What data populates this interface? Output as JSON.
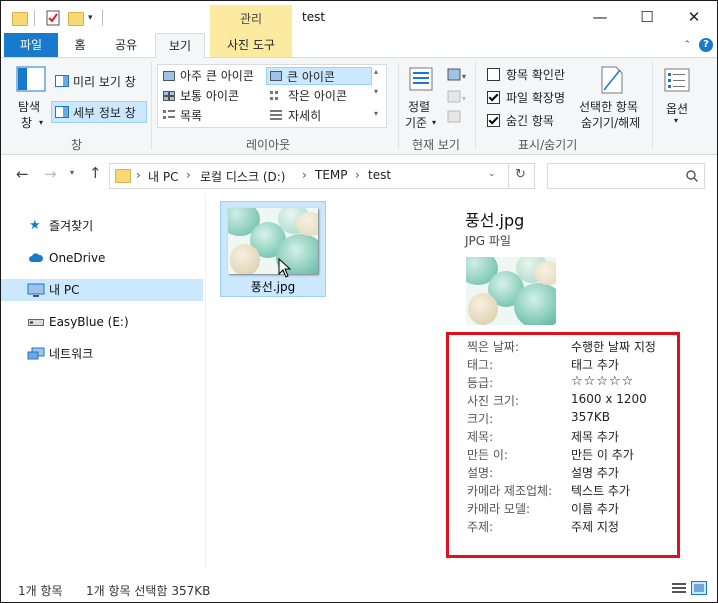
{
  "window": {
    "title": "test",
    "context_tab": "관리",
    "min_glyph": "—",
    "max_glyph": "☐",
    "close_glyph": "✕"
  },
  "tabs": {
    "file": "파일",
    "home": "홈",
    "share": "공유",
    "view": "보기",
    "picture_tools": "사진 도구",
    "help": "?"
  },
  "ribbon": {
    "pane_group": {
      "navpane_label_1": "탐색",
      "navpane_label_2": "창",
      "preview": "미리 보기 창",
      "details": "세부 정보 창",
      "group_label": "창"
    },
    "layout_group": {
      "items": [
        "아주 큰 아이콘",
        "큰 아이콘",
        "보통 아이콘",
        "작은 아이콘",
        "목록",
        "자세히"
      ],
      "group_label": "레이아웃"
    },
    "current_view_group": {
      "sort_1": "정렬",
      "sort_2": "기준",
      "group_label": "현재 보기"
    },
    "showhide_group": {
      "checkbox_item": "항목 확인란",
      "file_ext": "파일 확장명",
      "hidden_items": "숨긴 항목",
      "hide_selected_1": "선택한 항목",
      "hide_selected_2": "숨기기/해제",
      "group_label": "표시/숨기기"
    },
    "options": "옵션"
  },
  "address": {
    "path": [
      "내 PC",
      "로컬 디스크 (D:)",
      "TEMP",
      "test"
    ],
    "sep": "›"
  },
  "nav": {
    "items": [
      {
        "label": "즐겨찾기"
      },
      {
        "label": "OneDrive"
      },
      {
        "label": "내 PC"
      },
      {
        "label": "EasyBlue (E:)"
      },
      {
        "label": "네트워크"
      }
    ]
  },
  "content": {
    "file_name": "풍선.jpg"
  },
  "details": {
    "title": "풍선.jpg",
    "type": "JPG 파일",
    "rating_stars": "☆☆☆☆☆",
    "props": [
      {
        "k": "찍은 날짜:",
        "v": "수행한 날짜 지정"
      },
      {
        "k": "태그:",
        "v": "태그 추가"
      },
      {
        "k": "등급:",
        "v": ""
      },
      {
        "k": "사진 크기:",
        "v": "1600 x 1200"
      },
      {
        "k": "크기:",
        "v": "357KB"
      },
      {
        "k": "제목:",
        "v": "제목 추가"
      },
      {
        "k": "만든 이:",
        "v": "만든 이 추가"
      },
      {
        "k": "설명:",
        "v": "설명 추가"
      },
      {
        "k": "카메라 제조업체:",
        "v": "텍스트 추가"
      },
      {
        "k": "카메라 모델:",
        "v": "이름 추가"
      },
      {
        "k": "주제:",
        "v": "주제 지정"
      }
    ]
  },
  "status": {
    "count": "1개 항목",
    "selected": "1개 항목 선택함 357KB"
  },
  "colors": {
    "accent": "#1979ca",
    "selection": "#cce8ff",
    "highlight_border": "#e0101d",
    "context_tab": "#fbeaa0"
  }
}
